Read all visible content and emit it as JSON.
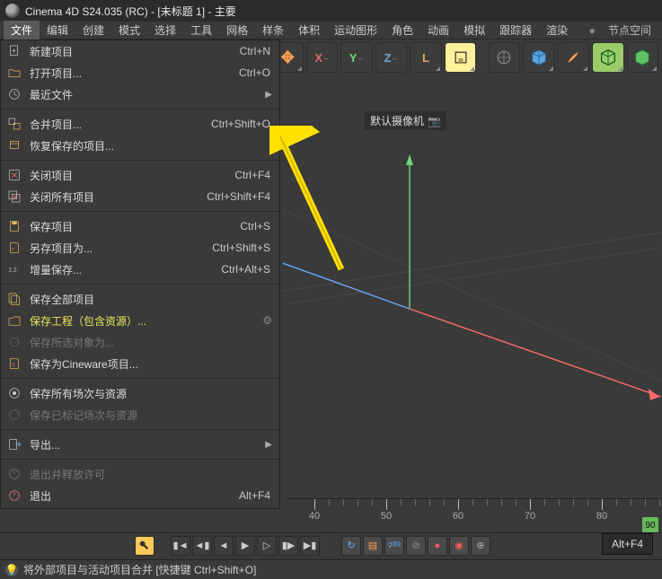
{
  "title": "Cinema 4D S24.035 (RC) - [未标题 1] - 主要",
  "menubar": {
    "items": [
      {
        "label": "文件",
        "active": true
      },
      {
        "label": "编辑"
      },
      {
        "label": "创建"
      },
      {
        "label": "模式"
      },
      {
        "label": "选择"
      },
      {
        "label": "工具"
      },
      {
        "label": "网格"
      },
      {
        "label": "样条"
      },
      {
        "label": "体积"
      },
      {
        "label": "运动图形"
      },
      {
        "label": "角色"
      },
      {
        "label": "动画"
      },
      {
        "label": "模拟"
      },
      {
        "label": "跟踪器"
      },
      {
        "label": "渲染"
      }
    ],
    "right_item": "节点空间"
  },
  "toolbar": {
    "buttons": [
      {
        "name": "move-tool",
        "sym": "✥",
        "color": "#ffa050"
      },
      {
        "name": "axis-lock-x",
        "sym": "X",
        "class": "axis-x"
      },
      {
        "name": "axis-lock-y",
        "sym": "Y",
        "class": "axis-y"
      },
      {
        "name": "axis-lock-z",
        "sym": "Z",
        "class": "axis-z"
      },
      {
        "name": "axis-lock-l",
        "sym": "L",
        "class": "axis-l"
      }
    ]
  },
  "viewport": {
    "camera_label": "默认摄像机"
  },
  "file_menu": [
    {
      "icon": "doc-plus-icon",
      "label": "新建项目",
      "shortcut": "Ctrl+N",
      "interactable": true
    },
    {
      "icon": "folder-open-icon",
      "label": "打开项目...",
      "shortcut": "Ctrl+O",
      "interactable": true
    },
    {
      "icon": "history-icon",
      "label": "最近文件",
      "sub": true,
      "interactable": true
    },
    {
      "sep": true
    },
    {
      "icon": "merge-icon",
      "label": "合并项目...",
      "shortcut": "Ctrl+Shift+O",
      "interactable": true,
      "highlight": true
    },
    {
      "icon": "restore-icon",
      "label": "恢复保存的项目...",
      "interactable": true
    },
    {
      "sep": true
    },
    {
      "icon": "close-icon",
      "label": "关闭项目",
      "shortcut": "Ctrl+F4",
      "interactable": true
    },
    {
      "icon": "close-all-icon",
      "label": "关闭所有项目",
      "shortcut": "Ctrl+Shift+F4",
      "interactable": true
    },
    {
      "sep": true
    },
    {
      "icon": "save-icon",
      "label": "保存项目",
      "shortcut": "Ctrl+S",
      "interactable": true
    },
    {
      "icon": "save-as-icon",
      "label": "另存项目为...",
      "shortcut": "Ctrl+Shift+S",
      "interactable": true
    },
    {
      "icon": "save-inc-icon",
      "label": "增量保存...",
      "shortcut": "Ctrl+Alt+S",
      "interactable": true
    },
    {
      "sep": true
    },
    {
      "icon": "save-all-icon",
      "label": "保存全部项目",
      "interactable": true
    },
    {
      "icon": "save-assets-icon",
      "label": "保存工程（包含资源）...",
      "yellow": true,
      "gear": true,
      "interactable": true
    },
    {
      "icon": "save-sel-icon",
      "label": "保存所选对象为...",
      "dim": true,
      "interactable": false
    },
    {
      "icon": "save-cineware-icon",
      "label": "保存为Cineware项目...",
      "interactable": true
    },
    {
      "sep": true
    },
    {
      "icon": "save-all-scenes-icon",
      "label": "保存所有场次与资源",
      "interactable": true
    },
    {
      "icon": "save-marked-icon",
      "label": "保存已标记场次与资源",
      "dim": true,
      "interactable": false
    },
    {
      "sep": true
    },
    {
      "icon": "export-icon",
      "label": "导出...",
      "sub": true,
      "interactable": true
    },
    {
      "sep": true
    },
    {
      "icon": "quit-release-icon",
      "label": "退出并释放许可",
      "dim": true,
      "interactable": true
    },
    {
      "icon": "quit-icon",
      "label": "退出",
      "shortcut": "Alt+F4",
      "interactable": true
    }
  ],
  "ruler": {
    "majors": [
      40,
      50,
      60,
      70,
      80
    ],
    "end": "90"
  },
  "tooltip": "Alt+F4",
  "status": "将外部项目与活动项目合并  [快捷键  Ctrl+Shift+O]"
}
